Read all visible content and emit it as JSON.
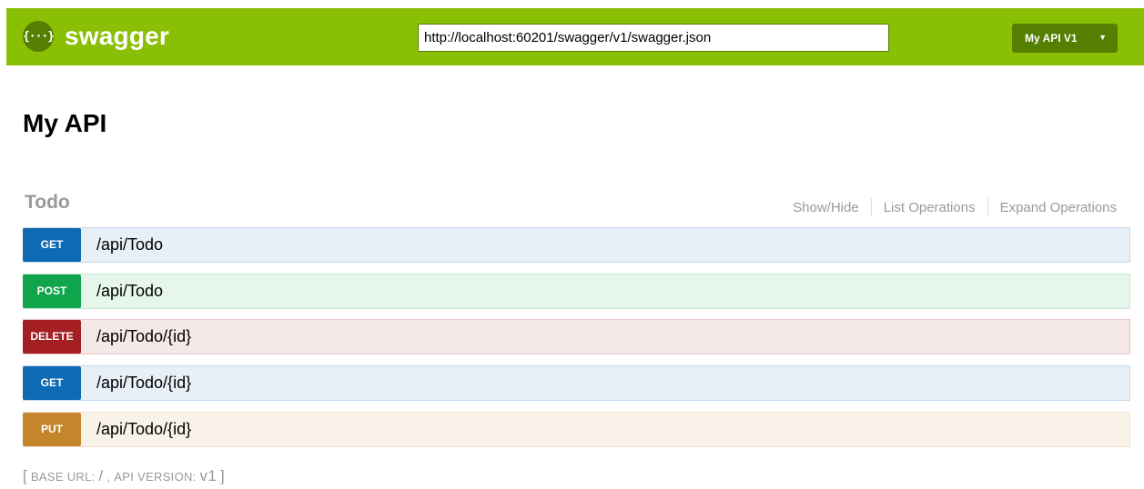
{
  "header": {
    "logo_glyph": "{···}",
    "logo_text": "swagger",
    "url_value": "http://localhost:60201/swagger/v1/swagger.json",
    "spec_select": {
      "selected": "My API V1",
      "caret": "▼"
    },
    "colors": {
      "bar": "#89bf04",
      "dark": "#547f00"
    }
  },
  "api_title": "My API",
  "resource": {
    "name": "Todo",
    "actions": [
      "Show/Hide",
      "List Operations",
      "Expand Operations"
    ]
  },
  "operations": [
    {
      "method": "GET",
      "path": "/api/Todo",
      "color": "#0f6ab4"
    },
    {
      "method": "POST",
      "path": "/api/Todo",
      "color": "#10a54a"
    },
    {
      "method": "DELETE",
      "path": "/api/Todo/{id}",
      "color": "#a41e22"
    },
    {
      "method": "GET",
      "path": "/api/Todo/{id}",
      "color": "#0f6ab4"
    },
    {
      "method": "PUT",
      "path": "/api/Todo/{id}",
      "color": "#c5862b"
    }
  ],
  "footer": {
    "open": "[",
    "base_url_label": "BASE URL:",
    "base_url_value": "/",
    "comma": ",",
    "api_version_label": "API VERSION:",
    "api_version_value": "v1",
    "close": "]"
  }
}
